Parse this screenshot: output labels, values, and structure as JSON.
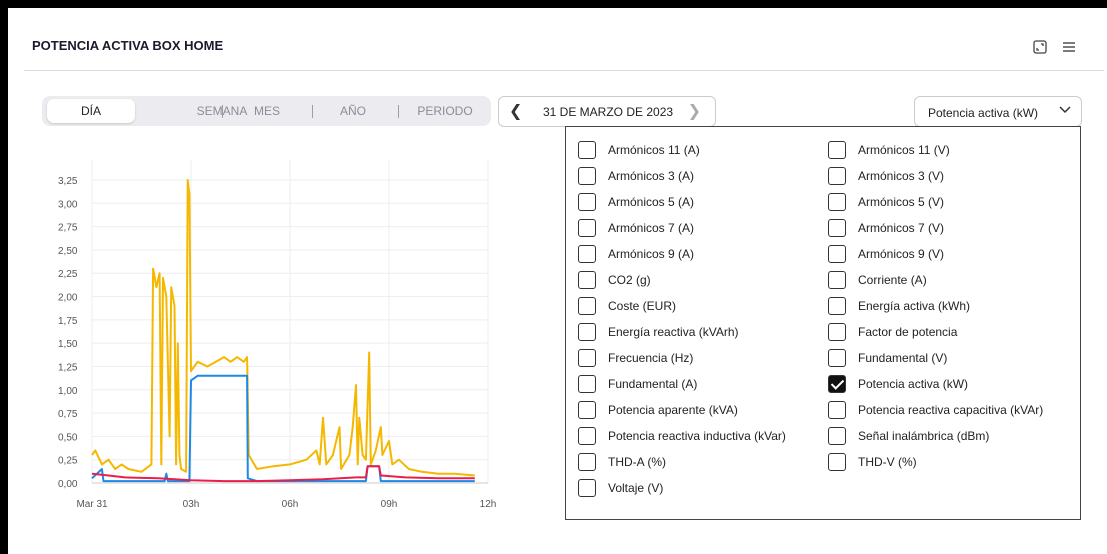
{
  "header": {
    "title": "POTENCIA ACTIVA BOX HOME"
  },
  "tabs": [
    "DÍA",
    "SEMANA",
    "MES",
    "AÑO",
    "PERIODO"
  ],
  "active_tab": "DÍA",
  "date": {
    "label": "31 DE MARZO DE 2023"
  },
  "metric_select": {
    "value": "Potencia activa (kW)"
  },
  "icons": {
    "expand": "expand-icon",
    "menu": "menu-icon",
    "prev": "chevron-left-icon",
    "next": "chevron-right-icon",
    "caret": "chevron-down-icon"
  },
  "options_left": [
    {
      "label": "Armónicos 11 (A)",
      "checked": false
    },
    {
      "label": "Armónicos 3 (A)",
      "checked": false
    },
    {
      "label": "Armónicos 5 (A)",
      "checked": false
    },
    {
      "label": "Armónicos 7 (A)",
      "checked": false
    },
    {
      "label": "Armónicos 9 (A)",
      "checked": false
    },
    {
      "label": "CO2 (g)",
      "checked": false
    },
    {
      "label": "Coste (EUR)",
      "checked": false
    },
    {
      "label": "Energía reactiva (kVArh)",
      "checked": false
    },
    {
      "label": "Frecuencia (Hz)",
      "checked": false
    },
    {
      "label": "Fundamental (A)",
      "checked": false
    },
    {
      "label": "Potencia aparente (kVA)",
      "checked": false
    },
    {
      "label": "Potencia reactiva inductiva (kVar)",
      "checked": false
    },
    {
      "label": "THD-A (%)",
      "checked": false
    },
    {
      "label": "Voltaje (V)",
      "checked": false
    }
  ],
  "options_right": [
    {
      "label": "Armónicos 11 (V)",
      "checked": false
    },
    {
      "label": "Armónicos 3 (V)",
      "checked": false
    },
    {
      "label": "Armónicos 5 (V)",
      "checked": false
    },
    {
      "label": "Armónicos 7 (V)",
      "checked": false
    },
    {
      "label": "Armónicos 9 (V)",
      "checked": false
    },
    {
      "label": "Corriente (A)",
      "checked": false
    },
    {
      "label": "Energía activa (kWh)",
      "checked": false
    },
    {
      "label": "Factor de potencia",
      "checked": false
    },
    {
      "label": "Fundamental (V)",
      "checked": false
    },
    {
      "label": "Potencia activa (kW)",
      "checked": true
    },
    {
      "label": "Potencia reactiva capacitiva (kVAr)",
      "checked": false
    },
    {
      "label": "Señal inalámbrica (dBm)",
      "checked": false
    },
    {
      "label": "THD-V (%)",
      "checked": false
    }
  ],
  "chart_data": {
    "type": "line",
    "x_ticks": [
      "Mar 31",
      "03h",
      "06h",
      "09h",
      "12h"
    ],
    "x_tick_hours": [
      0,
      3,
      6,
      9,
      12
    ],
    "y_ticks": [
      "0,00",
      "0,25",
      "0,50",
      "0,75",
      "1,00",
      "1,25",
      "1,50",
      "1,75",
      "2,00",
      "2,25",
      "2,50",
      "2,75",
      "3,00",
      "3,25"
    ],
    "ylim": [
      0,
      3.25
    ],
    "xlim_hours": [
      0,
      12
    ],
    "grid": true,
    "series": [
      {
        "color": "#f5b800",
        "points": [
          [
            0,
            0.3
          ],
          [
            0.1,
            0.35
          ],
          [
            0.3,
            0.2
          ],
          [
            0.5,
            0.25
          ],
          [
            0.7,
            0.15
          ],
          [
            0.9,
            0.2
          ],
          [
            1.1,
            0.15
          ],
          [
            1.5,
            0.12
          ],
          [
            1.8,
            0.2
          ],
          [
            1.85,
            2.3
          ],
          [
            1.95,
            2.1
          ],
          [
            2.05,
            2.25
          ],
          [
            2.1,
            0.2
          ],
          [
            2.15,
            2.2
          ],
          [
            2.25,
            2.0
          ],
          [
            2.35,
            0.5
          ],
          [
            2.4,
            2.1
          ],
          [
            2.5,
            1.9
          ],
          [
            2.55,
            0.2
          ],
          [
            2.6,
            1.5
          ],
          [
            2.65,
            0.3
          ],
          [
            2.7,
            0.15
          ],
          [
            2.85,
            0.12
          ],
          [
            2.9,
            3.25
          ],
          [
            2.95,
            3.1
          ],
          [
            3.0,
            1.2
          ],
          [
            3.2,
            1.3
          ],
          [
            3.5,
            1.25
          ],
          [
            4.0,
            1.35
          ],
          [
            4.2,
            1.3
          ],
          [
            4.4,
            1.35
          ],
          [
            4.6,
            1.3
          ],
          [
            4.7,
            1.35
          ],
          [
            4.75,
            0.3
          ],
          [
            5.0,
            0.15
          ],
          [
            5.5,
            0.18
          ],
          [
            6.0,
            0.2
          ],
          [
            6.5,
            0.25
          ],
          [
            6.8,
            0.35
          ],
          [
            6.9,
            0.2
          ],
          [
            7.0,
            0.7
          ],
          [
            7.1,
            0.2
          ],
          [
            7.3,
            0.3
          ],
          [
            7.5,
            0.6
          ],
          [
            7.55,
            0.15
          ],
          [
            7.8,
            0.3
          ],
          [
            7.9,
            0.6
          ],
          [
            8.0,
            1.05
          ],
          [
            8.05,
            0.2
          ],
          [
            8.1,
            0.7
          ],
          [
            8.2,
            0.3
          ],
          [
            8.3,
            0.25
          ],
          [
            8.4,
            1.4
          ],
          [
            8.45,
            0.2
          ],
          [
            8.6,
            0.35
          ],
          [
            8.75,
            0.6
          ],
          [
            8.8,
            0.3
          ],
          [
            9.0,
            0.45
          ],
          [
            9.1,
            0.2
          ],
          [
            9.3,
            0.25
          ],
          [
            9.6,
            0.15
          ],
          [
            10.0,
            0.12
          ],
          [
            10.5,
            0.1
          ],
          [
            11.0,
            0.1
          ],
          [
            11.6,
            0.08
          ]
        ]
      },
      {
        "color": "#1e88e5",
        "points": [
          [
            0,
            0.05
          ],
          [
            0.3,
            0.15
          ],
          [
            0.35,
            0.02
          ],
          [
            1.8,
            0.02
          ],
          [
            2.2,
            0.02
          ],
          [
            2.25,
            0.1
          ],
          [
            2.3,
            0.02
          ],
          [
            2.95,
            0.02
          ],
          [
            3.0,
            1.1
          ],
          [
            3.2,
            1.15
          ],
          [
            4.0,
            1.15
          ],
          [
            4.7,
            1.15
          ],
          [
            4.72,
            0.05
          ],
          [
            5.0,
            0.02
          ],
          [
            8.3,
            0.02
          ],
          [
            8.35,
            0.18
          ],
          [
            8.7,
            0.18
          ],
          [
            8.75,
            0.02
          ],
          [
            11.6,
            0.02
          ]
        ]
      },
      {
        "color": "#e91e4b",
        "points": [
          [
            0,
            0.1
          ],
          [
            0.5,
            0.08
          ],
          [
            1.0,
            0.06
          ],
          [
            2.0,
            0.05
          ],
          [
            3.0,
            0.03
          ],
          [
            4.0,
            0.02
          ],
          [
            5.0,
            0.02
          ],
          [
            6.0,
            0.03
          ],
          [
            7.0,
            0.04
          ],
          [
            8.0,
            0.06
          ],
          [
            8.3,
            0.06
          ],
          [
            8.35,
            0.18
          ],
          [
            8.7,
            0.18
          ],
          [
            8.75,
            0.08
          ],
          [
            9.5,
            0.06
          ],
          [
            10.5,
            0.05
          ],
          [
            11.6,
            0.05
          ]
        ]
      }
    ]
  }
}
